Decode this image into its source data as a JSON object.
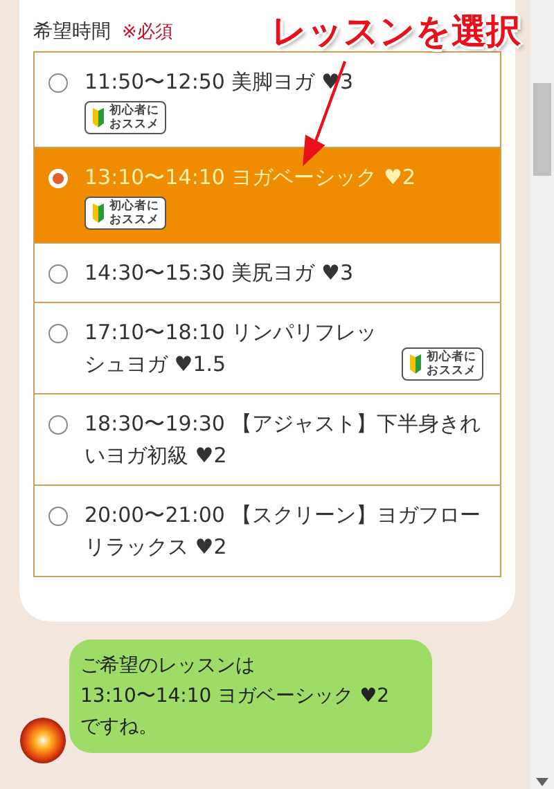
{
  "field": {
    "label": "希望時間",
    "required": "※必須"
  },
  "options": [
    {
      "kind": "badge-below",
      "text": "11:50〜12:50 美脚ヨガ ♥3",
      "selected": false,
      "badge": [
        "初心者に",
        "おススメ"
      ]
    },
    {
      "kind": "badge-below",
      "text": "13:10〜14:10 ヨガベーシック ♥2",
      "selected": true,
      "badge": [
        "初心者に",
        "おススメ"
      ]
    },
    {
      "kind": "plain",
      "text": "14:30〜15:30 美尻ヨガ ♥3",
      "selected": false
    },
    {
      "kind": "badge-inline",
      "text": "17:10〜18:10 リンパリフレッシュヨガ ♥1.5",
      "selected": false,
      "badge": [
        "初心者に",
        "おススメ"
      ]
    },
    {
      "kind": "plain",
      "text": "18:30〜19:30 【アジャスト】下半身きれいヨガ初級 ♥2",
      "selected": false
    },
    {
      "kind": "plain",
      "text": "20:00〜21:00 【スクリーン】ヨガフローリラックス ♥2",
      "selected": false
    }
  ],
  "annotation": {
    "text": "レッスンを選択"
  },
  "message": {
    "lines": [
      "ご希望のレッスンは",
      "13:10〜14:10 ヨガベーシック ♥2",
      "ですね。"
    ]
  }
}
